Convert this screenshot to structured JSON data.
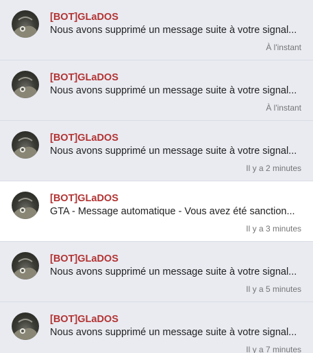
{
  "notifications": [
    {
      "author": "[BOT]GLaDOS",
      "message": "Nous avons supprimé un message suite à votre signal...",
      "time": "À l'instant",
      "read": false
    },
    {
      "author": "[BOT]GLaDOS",
      "message": "Nous avons supprimé un message suite à votre signal...",
      "time": "À l'instant",
      "read": false
    },
    {
      "author": "[BOT]GLaDOS",
      "message": "Nous avons supprimé un message suite à votre signal...",
      "time": "Il y a 2 minutes",
      "read": false
    },
    {
      "author": "[BOT]GLaDOS",
      "message": "GTA - Message automatique - Vous avez été sanction...",
      "time": "Il y a 3 minutes",
      "read": true
    },
    {
      "author": "[BOT]GLaDOS",
      "message": "Nous avons supprimé un message suite à votre signal...",
      "time": "Il y a 5 minutes",
      "read": false
    },
    {
      "author": "[BOT]GLaDOS",
      "message": "Nous avons supprimé un message suite à votre signal...",
      "time": "Il y a 7 minutes",
      "read": false
    }
  ],
  "colors": {
    "unread_bg": "#e9ebf1",
    "read_bg": "#ffffff",
    "author": "#b33434"
  },
  "icons": {
    "avatar": "glados-robot-avatar-icon"
  }
}
